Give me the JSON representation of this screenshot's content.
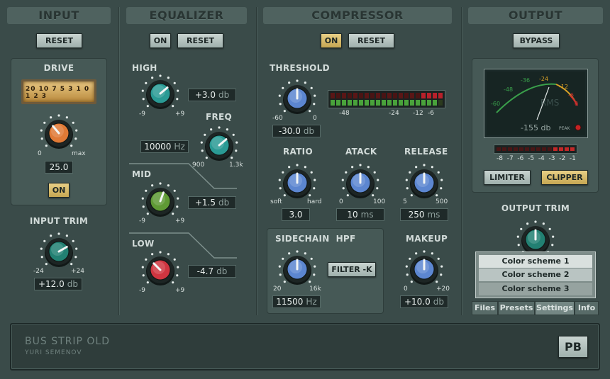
{
  "sections": {
    "input": "INPUT",
    "equalizer": "EQUALIZER",
    "compressor": "COMPRESSOR",
    "output": "OUTPUT"
  },
  "buttons": {
    "reset": "RESET",
    "on": "ON",
    "bypass": "BYPASS",
    "limiter": "LIMITER",
    "clipper": "CLIPPER",
    "filter": "FILTER -K",
    "pb": "PB"
  },
  "input": {
    "drive_label": "DRIVE",
    "drive_meter_ticks": [
      "20",
      "10",
      "7",
      "5",
      "3",
      "1",
      "0",
      "1",
      "2",
      "3"
    ],
    "drive_min": "0",
    "drive_max": "max",
    "drive_value": "25.0",
    "trim_label": "INPUT TRIM",
    "trim_min": "-24",
    "trim_max": "+24",
    "trim_value": "+12.0",
    "trim_unit": "db"
  },
  "eq": {
    "high_label": "HIGH",
    "high_min": "-9",
    "high_max": "+9",
    "high_value": "+3.0",
    "high_unit": "db",
    "freq_label": "FREQ",
    "freq_min": "900",
    "freq_max": "1.3k",
    "freq_value": "10000",
    "freq_unit": "Hz",
    "mid_label": "MID",
    "mid_min": "-9",
    "mid_max": "+9",
    "mid_value": "+1.5",
    "mid_unit": "db",
    "low_label": "LOW",
    "low_min": "-9",
    "low_max": "+9",
    "low_value": "-4.7",
    "low_unit": "db"
  },
  "comp": {
    "threshold_label": "THRESHOLD",
    "threshold_min": "-60",
    "threshold_max": "0",
    "threshold_value": "-30.0",
    "threshold_unit": "db",
    "meter_ticks": [
      "-48",
      "-24",
      "-12",
      "-6"
    ],
    "ratio_label": "RATIO",
    "ratio_min": "soft",
    "ratio_max": "hard",
    "ratio_value": "3.0",
    "attack_label": "ATACK",
    "attack_min": "0",
    "attack_max": "100",
    "attack_value": "10",
    "attack_unit": "ms",
    "release_label": "RELEASE",
    "release_min": "5",
    "release_max": "500",
    "release_value": "250",
    "release_unit": "ms",
    "sidechain_label": "SIDECHAIN  HPF",
    "sc_min": "20",
    "sc_max": "16k",
    "sc_value": "11500",
    "sc_unit": "Hz",
    "makeup_label": "MAKEUP",
    "makeup_min": "0",
    "makeup_max": "+20",
    "makeup_value": "+10.0",
    "makeup_unit": "db"
  },
  "output": {
    "vu_ticks": [
      "-60",
      "-48",
      "-36",
      "-24",
      "-12",
      "-6",
      "0"
    ],
    "vu_mode": "RMS",
    "vu_readout": "-155 db",
    "vu_peak": "PEAK",
    "meter_ticks": [
      "-8",
      "-7",
      "-6",
      "-5",
      "-4",
      "-3",
      "-2",
      "-1"
    ],
    "trim_label": "OUTPUT TRIM"
  },
  "menu": {
    "items": [
      "Color scheme 1",
      "Color scheme 2",
      "Color scheme 3"
    ]
  },
  "tabs": [
    "Files",
    "Presets",
    "Settings",
    "Info"
  ],
  "footer": {
    "title": "BUS STRIP OLD",
    "author": "YURI SEMENOV"
  },
  "colors": {
    "accent_on": "#e0c473",
    "knob_orange": "#e07a36",
    "knob_teal": "#2a9a94",
    "knob_green": "#5f9a35",
    "knob_red": "#cf3540",
    "knob_blue": "#5c86d0",
    "knob_dteal": "#228072"
  }
}
